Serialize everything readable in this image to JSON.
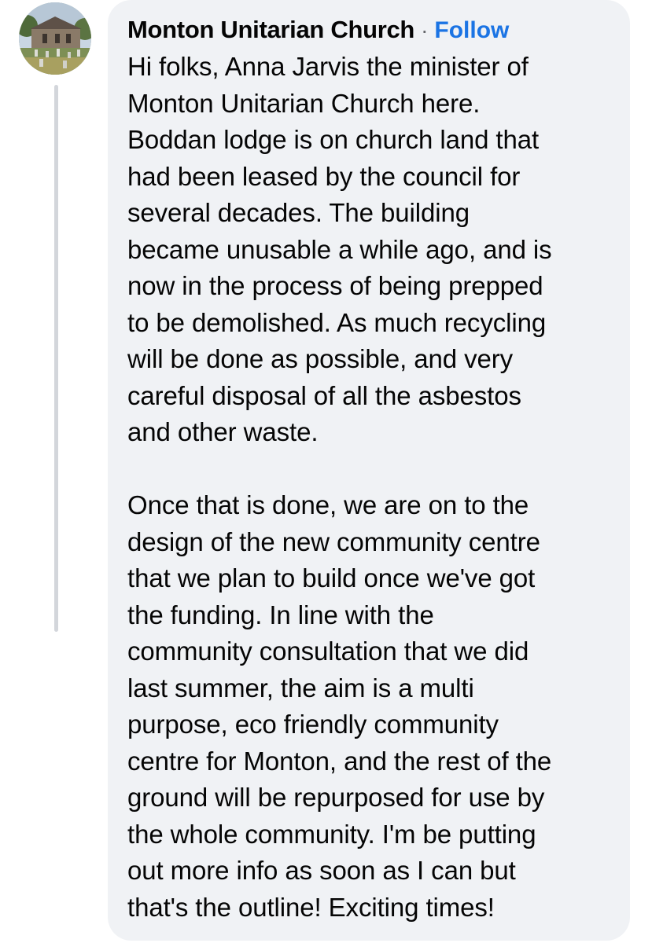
{
  "comment": {
    "author": "Monton Unitarian Church",
    "separator": "·",
    "follow_label": "Follow",
    "paragraph_1": "Hi folks, Anna Jarvis the minister of\nMonton Unitarian Church here.\nBoddan lodge is on church land that\nhad been leased by the council for\nseveral decades. The building\nbecame unusable a while ago, and is\nnow in the process of being prepped\nto be demolished. As much recycling\nwill be done as possible, and very\ncareful disposal of all the asbestos\nand other waste.",
    "paragraph_2": "Once that is done, we are on to the\ndesign of the new community centre\nthat we plan to build once we've got\nthe funding. In line with the\ncommunity consultation that we did\nlast summer, the aim is a multi\npurpose, eco friendly community\ncentre for Monton, and the rest of the\nground will be repurposed for use by\nthe whole community. I'm be putting\nout more info as soon as I can but\nthat's the outline! Exciting times!"
  },
  "colors": {
    "bubble_background": "#f0f2f5",
    "follow_link": "#1b74e4",
    "text": "#050505",
    "thread_line": "#d3d6db"
  },
  "icons": {
    "avatar": "church-photo-avatar"
  }
}
